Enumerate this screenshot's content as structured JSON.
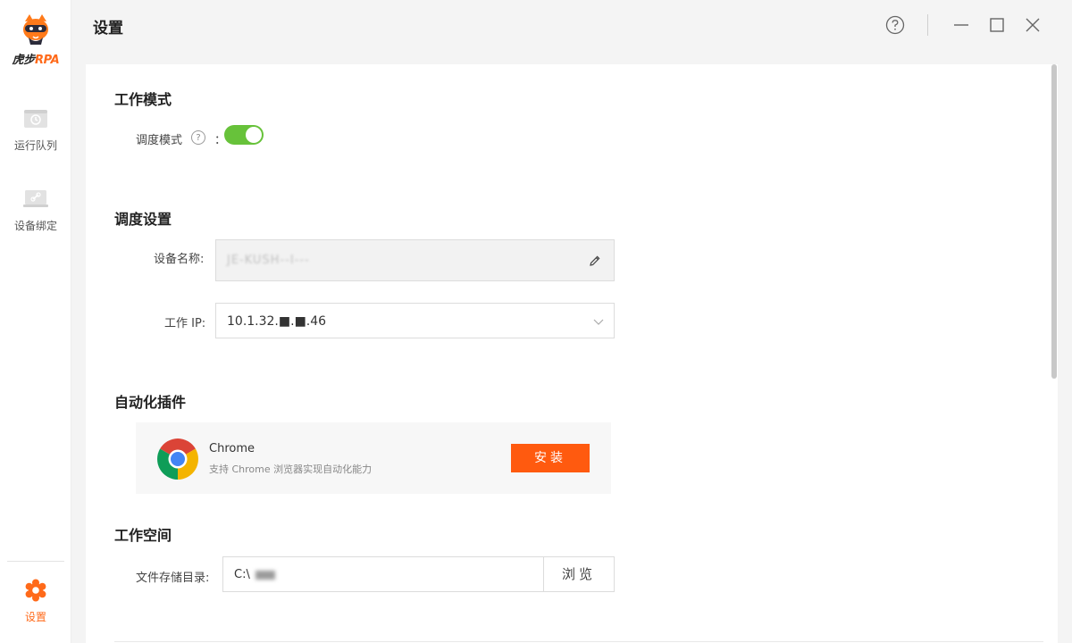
{
  "app": {
    "brand_cn": "虎步",
    "brand_en": "RPA",
    "accent_color": "#ff6a1a"
  },
  "sidebar": {
    "items": [
      {
        "label": "运行队列",
        "icon": "clock-icon"
      },
      {
        "label": "设备绑定",
        "icon": "device-link-icon"
      },
      {
        "label": "设置",
        "icon": "settings-gear-icon",
        "active": true
      }
    ]
  },
  "header": {
    "title": "设置",
    "controls": [
      "help-icon",
      "minimize-icon",
      "maximize-icon",
      "close-icon"
    ]
  },
  "work_mode": {
    "title": "工作模式",
    "schedule_mode_label": "调度模式",
    "help_glyph": "?",
    "colon": "：",
    "schedule_mode_enabled": true,
    "toggle_color": "#67c23a"
  },
  "schedule_settings": {
    "title": "调度设置",
    "device_name_label": "设备名称:",
    "device_name_value": "JE-KUSH--I---",
    "work_ip_label": "工作 IP:",
    "work_ip_value": "10.1.32.■.■.46"
  },
  "plugins": {
    "title": "自动化插件",
    "items": [
      {
        "name": "Chrome",
        "description": "支持 Chrome 浏览器实现自动化能力",
        "action_label": "安装",
        "action_color": "#ff5a0f"
      }
    ]
  },
  "workspace": {
    "title": "工作空间",
    "dir_label": "文件存储目录:",
    "dir_value": "C:\\",
    "browse_label": "浏览"
  }
}
